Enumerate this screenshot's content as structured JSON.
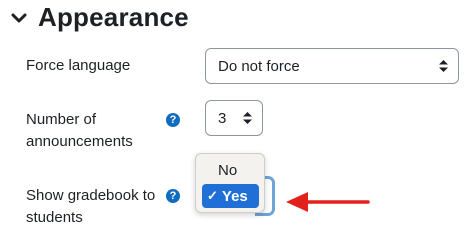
{
  "section": {
    "title": "Appearance"
  },
  "fields": {
    "force_language": {
      "label": "Force language",
      "value": "Do not force"
    },
    "announcements": {
      "label_line1": "Number of",
      "label_line2": "announcements",
      "value": "3"
    },
    "gradebook": {
      "label_line1": "Show gradebook to",
      "label_line2": "students",
      "options": [
        "No",
        "Yes"
      ],
      "selected": "Yes"
    }
  },
  "icons": {
    "help": "?",
    "check": "✓"
  },
  "colors": {
    "accent": "#0f6cbf",
    "selected_option": "#1f6fd6",
    "arrow": "#e3211c"
  }
}
